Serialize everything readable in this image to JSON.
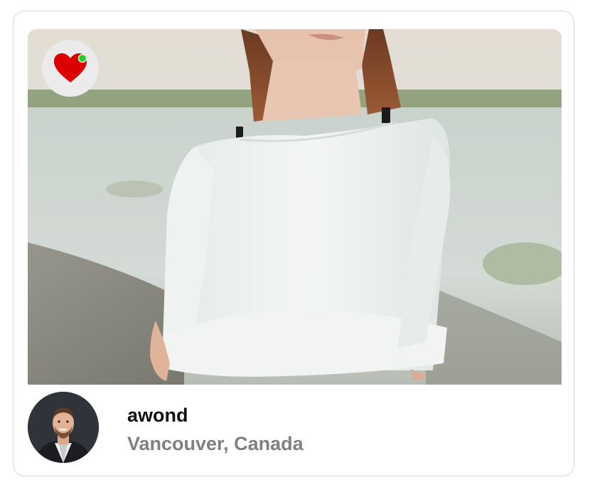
{
  "profile_card": {
    "username": "awond",
    "location": "Vancouver, Canada"
  },
  "icons": {
    "favorite": "heart-icon",
    "online_status": "online-dot-icon"
  },
  "colors": {
    "heart": "#dd0000",
    "online_dot": "#22cc22",
    "location_text": "#808080"
  }
}
